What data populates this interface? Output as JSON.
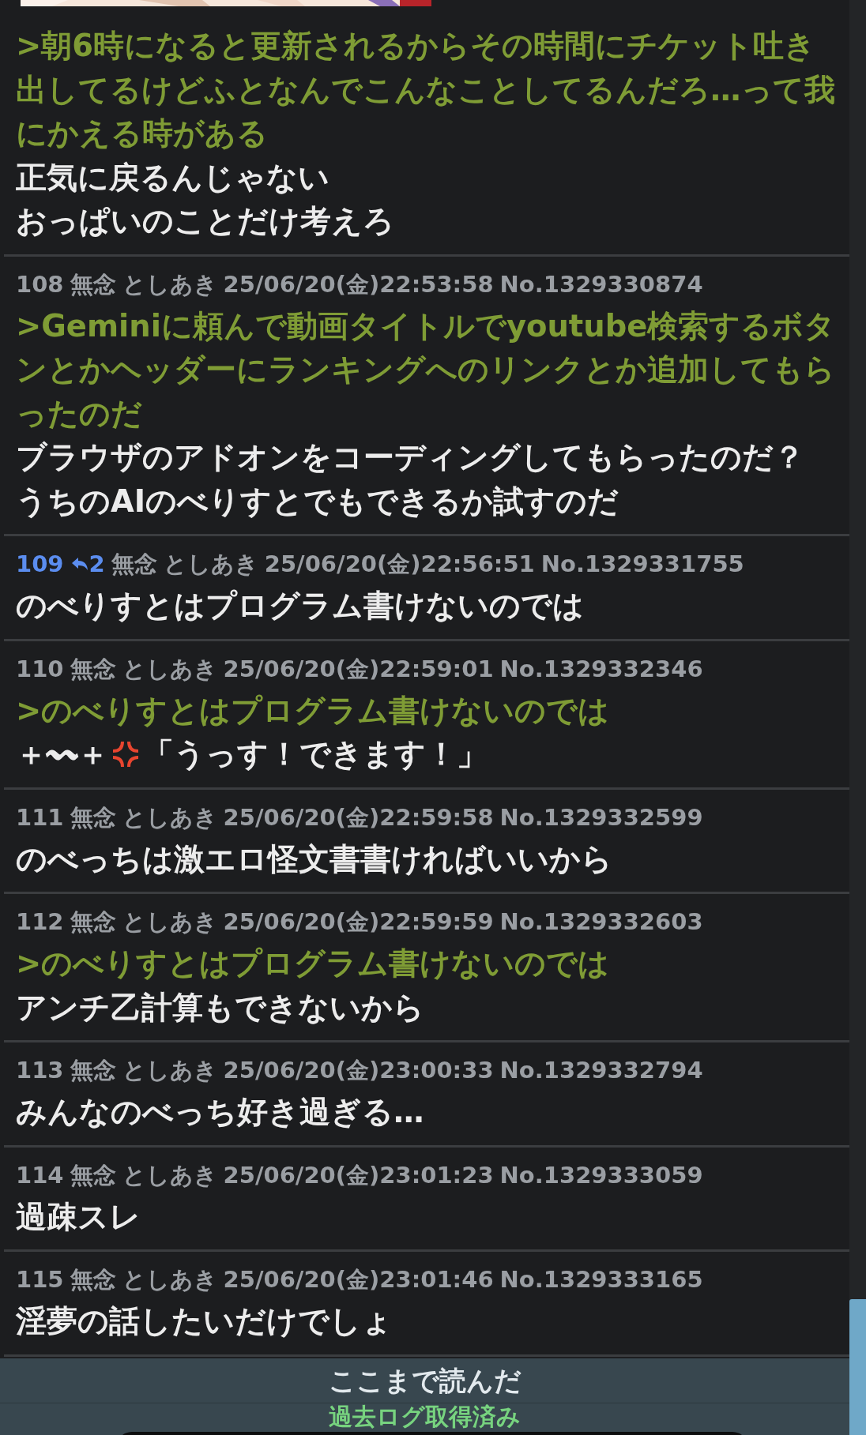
{
  "partial_post": {
    "lines": [
      {
        "kind": "quote",
        "text": ">朝6時になると更新されるからその時間にチケット吐き出してるけどふとなんでこんなことしてるんだろ…って我にかえる時がある"
      },
      {
        "kind": "text",
        "text": "正気に戻るんじゃない"
      },
      {
        "kind": "text",
        "text": "おっぱいのことだけ考えろ"
      }
    ]
  },
  "posts": [
    {
      "number": "108",
      "name": "無念",
      "author": "としあき",
      "datetime": "25/06/20(金)22:53:58",
      "post_no": "No.1329330874",
      "lines": [
        {
          "kind": "quote",
          "text": ">Geminiに頼んで動画タイトルでyoutube検索するボタンとかヘッダーにランキングへのリンクとか追加してもらったのだ"
        },
        {
          "kind": "text",
          "text": "ブラウザのアドオンをコーディングしてもらったのだ？"
        },
        {
          "kind": "text",
          "text": "うちのAIのべりすとでもできるか試すのだ"
        }
      ]
    },
    {
      "number": "109",
      "reply_count": "2",
      "name": "無念",
      "author": "としあき",
      "datetime": "25/06/20(金)22:56:51",
      "post_no": "No.1329331755",
      "lines": [
        {
          "kind": "text",
          "text": "のべりすとはプログラム書けないのでは"
        }
      ]
    },
    {
      "number": "110",
      "name": "無念",
      "author": "としあき",
      "datetime": "25/06/20(金)22:59:01",
      "post_no": "No.1329332346",
      "lines": [
        {
          "kind": "quote",
          "text": ">のべりすとはプログラム書けないのでは"
        },
        {
          "kind": "mixed",
          "segments": [
            {
              "kind": "text",
              "text": "＋〰＋"
            },
            {
              "kind": "anger_icon"
            },
            {
              "kind": "text",
              "text": "「うっす！できます！」"
            }
          ]
        }
      ]
    },
    {
      "number": "111",
      "name": "無念",
      "author": "としあき",
      "datetime": "25/06/20(金)22:59:58",
      "post_no": "No.1329332599",
      "lines": [
        {
          "kind": "text",
          "text": "のべっちは激エロ怪文書書ければいいから"
        }
      ]
    },
    {
      "number": "112",
      "name": "無念",
      "author": "としあき",
      "datetime": "25/06/20(金)22:59:59",
      "post_no": "No.1329332603",
      "lines": [
        {
          "kind": "quote",
          "text": ">のべりすとはプログラム書けないのでは"
        },
        {
          "kind": "text",
          "text": "アンチ乙計算もできないから"
        }
      ]
    },
    {
      "number": "113",
      "name": "無念",
      "author": "としあき",
      "datetime": "25/06/20(金)23:00:33",
      "post_no": "No.1329332794",
      "lines": [
        {
          "kind": "text",
          "text": "みんなのべっち好き過ぎる…"
        }
      ]
    },
    {
      "number": "114",
      "name": "無念",
      "author": "としあき",
      "datetime": "25/06/20(金)23:01:23",
      "post_no": "No.1329333059",
      "lines": [
        {
          "kind": "text",
          "text": "過疎スレ"
        }
      ]
    },
    {
      "number": "115",
      "name": "無念",
      "author": "としあき",
      "datetime": "25/06/20(金)23:01:46",
      "post_no": "No.1329333165",
      "lines": [
        {
          "kind": "text",
          "text": "淫夢の話したいだけでしょ"
        }
      ]
    }
  ],
  "read_marker": "ここまで読んだ",
  "archive_status": "過去ログ取得済み"
}
